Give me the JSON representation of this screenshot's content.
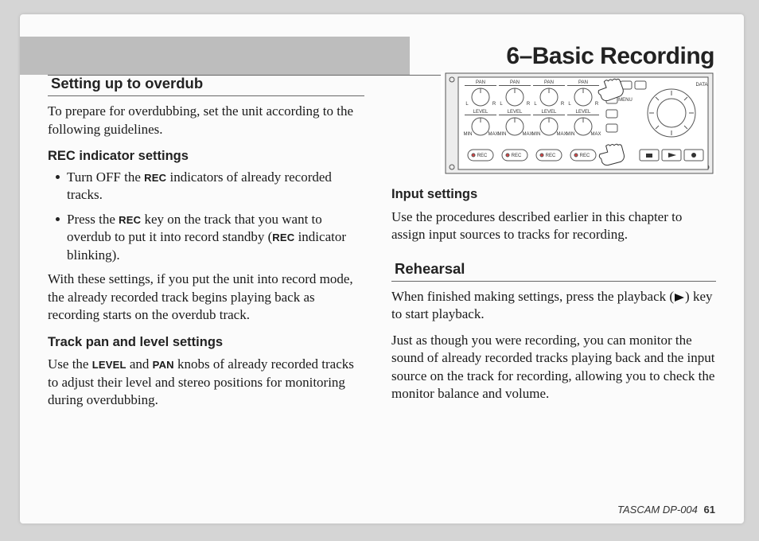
{
  "chapter_title": "6–Basic Recording",
  "footer": {
    "product": "TASCAM  DP-004",
    "page": "61"
  },
  "left": {
    "section1": {
      "heading": "Setting up to overdub",
      "intro": "To prepare for overdubbing, set the unit according to the following guidelines.",
      "sub1": {
        "heading": "REC indicator settings",
        "b1a": "Turn OFF the ",
        "b1b": " indicators of already recorded tracks.",
        "b2a": "Press the ",
        "b2b": " key on the track that you want to overdub to put it into record standby (",
        "b2c": " indicator blinking).",
        "para": "With these settings, if you put the unit into record mode, the already recorded track begins playing back as recording starts on the overdub track."
      },
      "sub2": {
        "heading": "Track pan and level settings",
        "p1a": "Use the ",
        "p1b": " and ",
        "p1c": " knobs of already recorded tracks to adjust their level and stereo positions for monitoring during overdubbing."
      }
    }
  },
  "right": {
    "sub1": {
      "heading": "Input settings",
      "para": "Use the procedures described earlier in this chapter to assign input sources to tracks for recording."
    },
    "section2": {
      "heading": "Rehearsal",
      "p1a": "When finished making settings, press the playback (",
      "p1b": ") key to start playback.",
      "p2": "Just as though you were recording, you can monitor the sound of already recorded tracks playing back and the input source on the track for recording, allowing you to check the monitor balance and volume."
    }
  },
  "labels": {
    "rec": "REC",
    "level": "LEVEL",
    "pan": "PAN"
  },
  "illus": {
    "pan": "PAN",
    "level": "LEVEL",
    "rec": "REC",
    "menu": "MENU",
    "data": "DATA",
    "l": "L",
    "r": "R",
    "min": "MIN",
    "max": "MAX"
  }
}
